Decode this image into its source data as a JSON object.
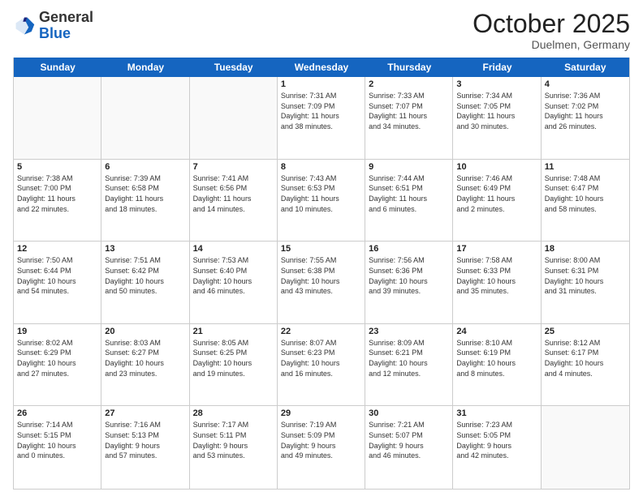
{
  "header": {
    "logo_general": "General",
    "logo_blue": "Blue",
    "month": "October 2025",
    "location": "Duelmen, Germany"
  },
  "weekdays": [
    "Sunday",
    "Monday",
    "Tuesday",
    "Wednesday",
    "Thursday",
    "Friday",
    "Saturday"
  ],
  "weeks": [
    [
      {
        "day": "",
        "info": ""
      },
      {
        "day": "",
        "info": ""
      },
      {
        "day": "",
        "info": ""
      },
      {
        "day": "1",
        "info": "Sunrise: 7:31 AM\nSunset: 7:09 PM\nDaylight: 11 hours\nand 38 minutes."
      },
      {
        "day": "2",
        "info": "Sunrise: 7:33 AM\nSunset: 7:07 PM\nDaylight: 11 hours\nand 34 minutes."
      },
      {
        "day": "3",
        "info": "Sunrise: 7:34 AM\nSunset: 7:05 PM\nDaylight: 11 hours\nand 30 minutes."
      },
      {
        "day": "4",
        "info": "Sunrise: 7:36 AM\nSunset: 7:02 PM\nDaylight: 11 hours\nand 26 minutes."
      }
    ],
    [
      {
        "day": "5",
        "info": "Sunrise: 7:38 AM\nSunset: 7:00 PM\nDaylight: 11 hours\nand 22 minutes."
      },
      {
        "day": "6",
        "info": "Sunrise: 7:39 AM\nSunset: 6:58 PM\nDaylight: 11 hours\nand 18 minutes."
      },
      {
        "day": "7",
        "info": "Sunrise: 7:41 AM\nSunset: 6:56 PM\nDaylight: 11 hours\nand 14 minutes."
      },
      {
        "day": "8",
        "info": "Sunrise: 7:43 AM\nSunset: 6:53 PM\nDaylight: 11 hours\nand 10 minutes."
      },
      {
        "day": "9",
        "info": "Sunrise: 7:44 AM\nSunset: 6:51 PM\nDaylight: 11 hours\nand 6 minutes."
      },
      {
        "day": "10",
        "info": "Sunrise: 7:46 AM\nSunset: 6:49 PM\nDaylight: 11 hours\nand 2 minutes."
      },
      {
        "day": "11",
        "info": "Sunrise: 7:48 AM\nSunset: 6:47 PM\nDaylight: 10 hours\nand 58 minutes."
      }
    ],
    [
      {
        "day": "12",
        "info": "Sunrise: 7:50 AM\nSunset: 6:44 PM\nDaylight: 10 hours\nand 54 minutes."
      },
      {
        "day": "13",
        "info": "Sunrise: 7:51 AM\nSunset: 6:42 PM\nDaylight: 10 hours\nand 50 minutes."
      },
      {
        "day": "14",
        "info": "Sunrise: 7:53 AM\nSunset: 6:40 PM\nDaylight: 10 hours\nand 46 minutes."
      },
      {
        "day": "15",
        "info": "Sunrise: 7:55 AM\nSunset: 6:38 PM\nDaylight: 10 hours\nand 43 minutes."
      },
      {
        "day": "16",
        "info": "Sunrise: 7:56 AM\nSunset: 6:36 PM\nDaylight: 10 hours\nand 39 minutes."
      },
      {
        "day": "17",
        "info": "Sunrise: 7:58 AM\nSunset: 6:33 PM\nDaylight: 10 hours\nand 35 minutes."
      },
      {
        "day": "18",
        "info": "Sunrise: 8:00 AM\nSunset: 6:31 PM\nDaylight: 10 hours\nand 31 minutes."
      }
    ],
    [
      {
        "day": "19",
        "info": "Sunrise: 8:02 AM\nSunset: 6:29 PM\nDaylight: 10 hours\nand 27 minutes."
      },
      {
        "day": "20",
        "info": "Sunrise: 8:03 AM\nSunset: 6:27 PM\nDaylight: 10 hours\nand 23 minutes."
      },
      {
        "day": "21",
        "info": "Sunrise: 8:05 AM\nSunset: 6:25 PM\nDaylight: 10 hours\nand 19 minutes."
      },
      {
        "day": "22",
        "info": "Sunrise: 8:07 AM\nSunset: 6:23 PM\nDaylight: 10 hours\nand 16 minutes."
      },
      {
        "day": "23",
        "info": "Sunrise: 8:09 AM\nSunset: 6:21 PM\nDaylight: 10 hours\nand 12 minutes."
      },
      {
        "day": "24",
        "info": "Sunrise: 8:10 AM\nSunset: 6:19 PM\nDaylight: 10 hours\nand 8 minutes."
      },
      {
        "day": "25",
        "info": "Sunrise: 8:12 AM\nSunset: 6:17 PM\nDaylight: 10 hours\nand 4 minutes."
      }
    ],
    [
      {
        "day": "26",
        "info": "Sunrise: 7:14 AM\nSunset: 5:15 PM\nDaylight: 10 hours\nand 0 minutes."
      },
      {
        "day": "27",
        "info": "Sunrise: 7:16 AM\nSunset: 5:13 PM\nDaylight: 9 hours\nand 57 minutes."
      },
      {
        "day": "28",
        "info": "Sunrise: 7:17 AM\nSunset: 5:11 PM\nDaylight: 9 hours\nand 53 minutes."
      },
      {
        "day": "29",
        "info": "Sunrise: 7:19 AM\nSunset: 5:09 PM\nDaylight: 9 hours\nand 49 minutes."
      },
      {
        "day": "30",
        "info": "Sunrise: 7:21 AM\nSunset: 5:07 PM\nDaylight: 9 hours\nand 46 minutes."
      },
      {
        "day": "31",
        "info": "Sunrise: 7:23 AM\nSunset: 5:05 PM\nDaylight: 9 hours\nand 42 minutes."
      },
      {
        "day": "",
        "info": ""
      }
    ]
  ]
}
